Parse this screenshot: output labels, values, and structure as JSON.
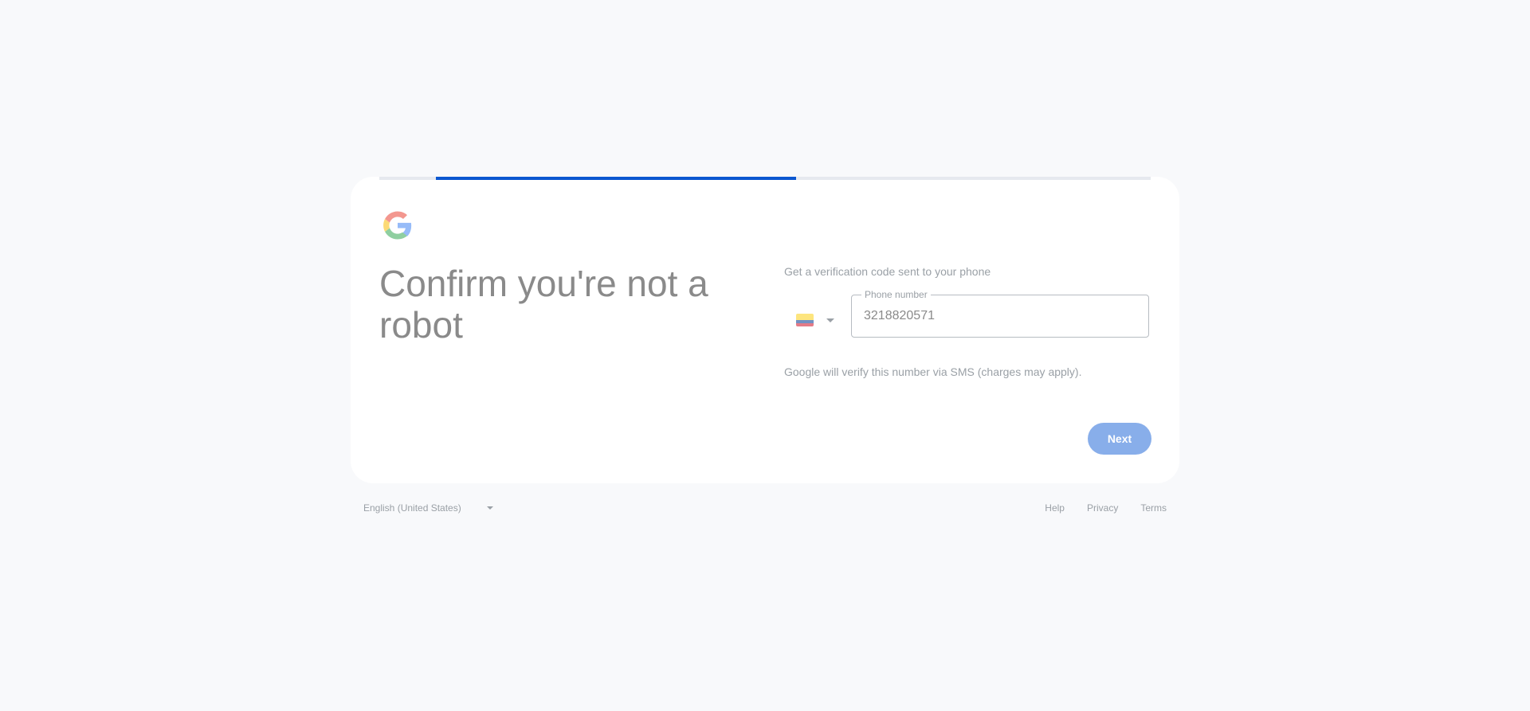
{
  "progress": {
    "start_fraction": 0.073,
    "fill_fraction": 0.467,
    "color": "#0b57d0"
  },
  "logo": {
    "icon": "google-g-icon",
    "colors": [
      "#ea4335",
      "#fbbc05",
      "#34a853",
      "#4285f4"
    ]
  },
  "heading": {
    "title": "Confirm you're not a robot"
  },
  "form": {
    "subtitle": "Get a verification code sent to your phone",
    "country": {
      "flag_icon": "colombia-flag-icon",
      "flag_colors": [
        "#fcd116",
        "#003893",
        "#ce1126"
      ]
    },
    "phone": {
      "label": "Phone number",
      "value": "3218820571"
    },
    "sms_note": "Google will verify this number via SMS (charges may apply).",
    "next_label": "Next",
    "next_color": "#88aeea"
  },
  "footer": {
    "language": "English (United States)",
    "links": [
      "Help",
      "Privacy",
      "Terms"
    ]
  }
}
